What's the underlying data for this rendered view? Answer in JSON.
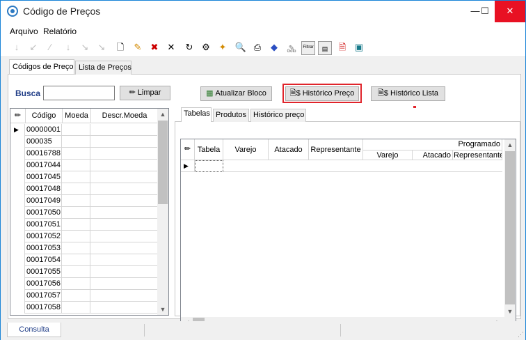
{
  "window": {
    "title": "Código de Preços",
    "minimize_icon": "minimize-icon",
    "maximize_icon": "maximize-icon",
    "close_icon": "close-icon"
  },
  "menu": [
    {
      "label": "Arquivo"
    },
    {
      "label": "Relatório"
    }
  ],
  "toolbar": {
    "icons": [
      "first-icon",
      "prev-page-icon",
      "prev-icon",
      "next-icon",
      "next-page-icon",
      "last-icon",
      "new-icon",
      "edit-icon",
      "delete-icon",
      "cancel-icon",
      "refresh-icon",
      "properties-icon",
      "wand-icon",
      "preview-icon",
      "print-icon",
      "post-icon",
      "goto-icon",
      "filter-icon",
      "filter-remove-icon",
      "export-icon",
      "exit-icon"
    ],
    "goto_label": "Goto",
    "filter_label": "Filtrar"
  },
  "tabs": [
    {
      "label": "Códigos de Preço",
      "active": true
    },
    {
      "label": "Lista de Preços",
      "active": false
    }
  ],
  "search": {
    "label": "Busca",
    "value": "",
    "clear_button": "Limpar",
    "clear_icon": "eraser-icon"
  },
  "actions": {
    "update_block": "Atualizar Bloco",
    "price_history": "Histórico Preço",
    "list_history": "Histórico Lista"
  },
  "left_grid": {
    "columns": [
      "Código",
      "Moeda",
      "Descr.Moeda"
    ],
    "rows": [
      "00000001",
      "000035",
      "00016788",
      "00017044",
      "00017045",
      "00017048",
      "00017049",
      "00017050",
      "00017051",
      "00017052",
      "00017053",
      "00017054",
      "00017055",
      "00017056",
      "00017057",
      "00017058"
    ]
  },
  "right_tabs": [
    {
      "label": "Tabelas",
      "active": true
    },
    {
      "label": "Produtos",
      "active": false
    },
    {
      "label": "Histórico preço",
      "active": false
    }
  ],
  "right_grid": {
    "columns": [
      "Tabela",
      "Varejo",
      "Atacado",
      "Representante"
    ],
    "group": "Programado",
    "group_columns": [
      "Varejo",
      "Atacado",
      "Representante"
    ]
  },
  "status": {
    "tab": "Consulta"
  }
}
